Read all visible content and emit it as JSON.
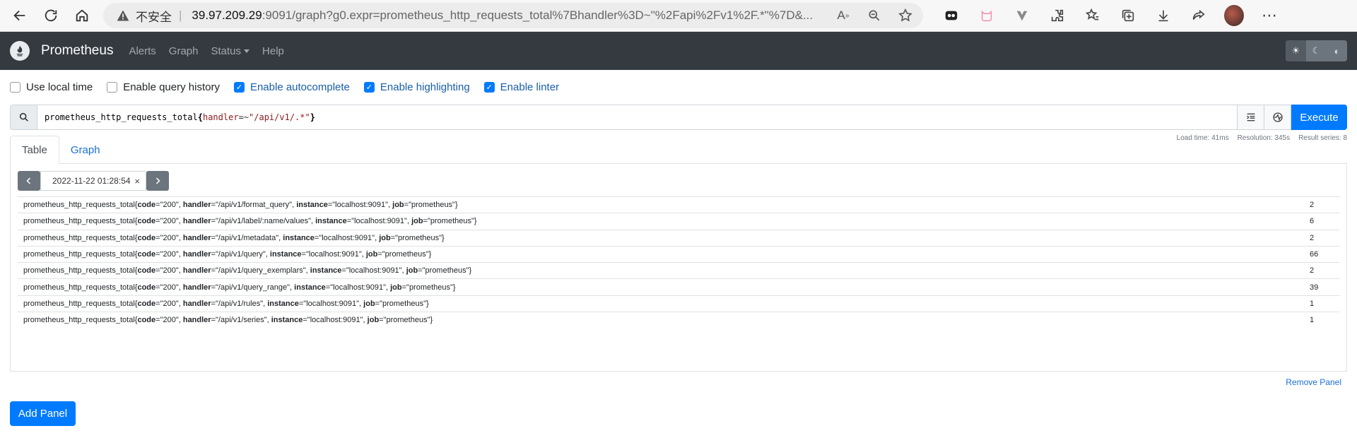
{
  "browser": {
    "insecure_label": "不安全",
    "separator": "|",
    "url_host": "39.97.209.29",
    "url_rest": ":9091/graph?g0.expr=prometheus_http_requests_total%7Bhandler%3D~\"%2Fapi%2Fv1%2F.*\"%7D&..."
  },
  "nav": {
    "brand": "Prometheus",
    "links": [
      "Alerts",
      "Graph",
      "Status",
      "Help"
    ]
  },
  "options": {
    "use_local_time": {
      "label": "Use local time",
      "checked": false
    },
    "enable_query_history": {
      "label": "Enable query history",
      "checked": false
    },
    "enable_autocomplete": {
      "label": "Enable autocomplete",
      "checked": true
    },
    "enable_highlighting": {
      "label": "Enable highlighting",
      "checked": true
    },
    "enable_linter": {
      "label": "Enable linter",
      "checked": true
    }
  },
  "expression": {
    "metric": "prometheus_http_requests_total",
    "open_brace": "{",
    "label": "handler",
    "operator": "=~",
    "value": "\"/api/v1/.*\"",
    "close_brace": "}",
    "execute_label": "Execute"
  },
  "tabs": {
    "table": "Table",
    "graph": "Graph"
  },
  "stats": {
    "load_time": "Load time: 41ms",
    "resolution": "Resolution: 345s",
    "result_series": "Result series: 8"
  },
  "timebar": {
    "value": "2022-11-22 01:28:54",
    "clear": "×"
  },
  "results": [
    {
      "handler": "/api/v1/format_query",
      "value": "2"
    },
    {
      "handler": "/api/v1/label/:name/values",
      "value": "6"
    },
    {
      "handler": "/api/v1/metadata",
      "value": "2"
    },
    {
      "handler": "/api/v1/query",
      "value": "66"
    },
    {
      "handler": "/api/v1/query_exemplars",
      "value": "2"
    },
    {
      "handler": "/api/v1/query_range",
      "value": "39"
    },
    {
      "handler": "/api/v1/rules",
      "value": "1"
    },
    {
      "handler": "/api/v1/series",
      "value": "1"
    }
  ],
  "result_labels": {
    "metric": "prometheus_http_requests_total",
    "code": "200",
    "instance": "localhost:9091",
    "job": "prometheus"
  },
  "actions": {
    "remove_panel": "Remove Panel",
    "add_panel": "Add Panel"
  }
}
